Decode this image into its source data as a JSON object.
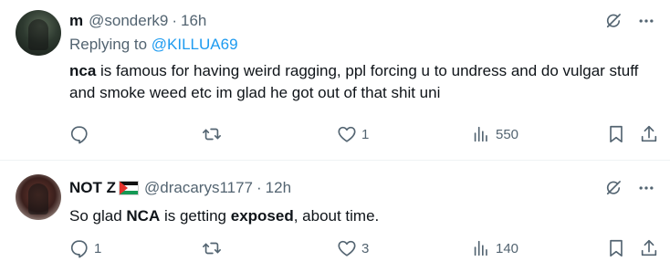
{
  "tweets": [
    {
      "name": "m",
      "handle": "@sonderk9",
      "separator": "·",
      "time": "16h",
      "replying_prefix": "Replying to ",
      "replying_handle": "@KILLUA69",
      "text_bold_1": "nca",
      "text_rest_1": " is famous for having weird ragging, ppl forcing u to undress and do vulgar stuff and smoke weed etc im glad he got out of that shit uni",
      "reply_count": "",
      "repost_count": "",
      "like_count": "1",
      "view_count": "550"
    },
    {
      "name": "NOT Z",
      "handle": "@dracarys1177",
      "separator": "·",
      "time": "12h",
      "text_plain_1": "So glad ",
      "text_bold_1": "NCA",
      "text_plain_2": " is getting ",
      "text_bold_2": "exposed",
      "text_plain_3": ", about time.",
      "reply_count": "1",
      "repost_count": "",
      "like_count": "3",
      "view_count": "140"
    }
  ],
  "icons": {
    "grok": "grok-icon",
    "more": "more-icon",
    "reply": "reply-icon",
    "repost": "repost-icon",
    "like": "like-icon",
    "views": "views-icon",
    "bookmark": "bookmark-icon",
    "share": "share-icon",
    "flag": "palestine-flag-icon"
  },
  "colors": {
    "text": "#0f1419",
    "muted": "#536471",
    "link": "#1d9bf0",
    "divider": "#eff3f4"
  }
}
